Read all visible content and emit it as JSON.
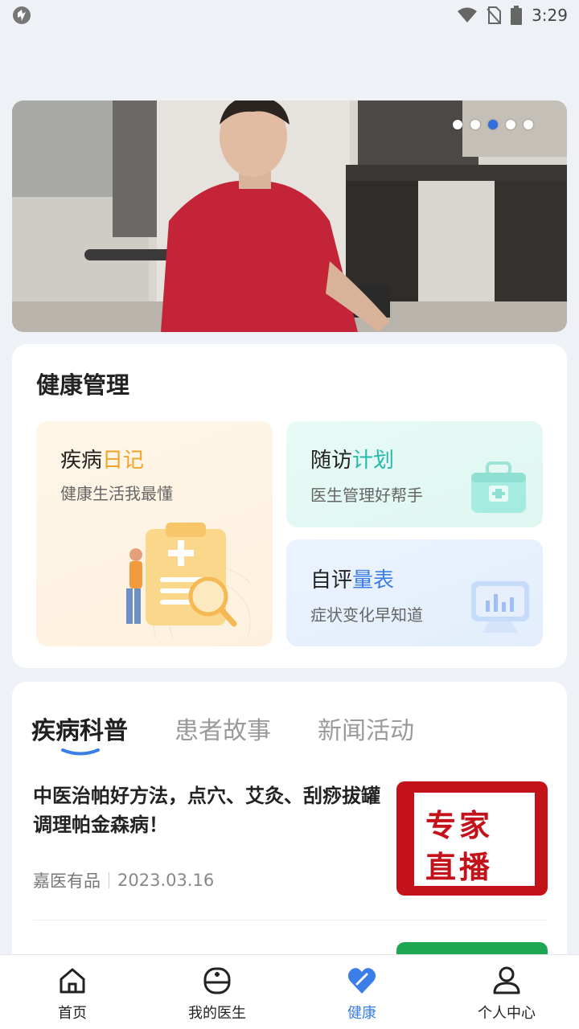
{
  "status_bar": {
    "time": "3:29"
  },
  "banner": {
    "dot_count": 5,
    "active_dot_index": 2
  },
  "health_management": {
    "title": "健康管理",
    "tiles": [
      {
        "title_plain": "疾病",
        "title_highlight": "日记",
        "subtitle": "健康生活我最懂",
        "accent": "#f2a329"
      },
      {
        "title_plain": "随访",
        "title_highlight": "计划",
        "subtitle": "医生管理好帮手",
        "accent": "#26b8a9"
      },
      {
        "title_plain": "自评",
        "title_highlight": "量表",
        "subtitle": "症状变化早知道",
        "accent": "#3c7ee8"
      }
    ]
  },
  "articles_section": {
    "tabs": [
      {
        "label": "疾病科普",
        "active": true
      },
      {
        "label": "患者故事",
        "active": false
      },
      {
        "label": "新闻活动",
        "active": false
      }
    ],
    "articles": [
      {
        "title": "中医治帕好方法，点穴、艾灸、刮痧拔罐调理帕金森病！",
        "source": "嘉医有品",
        "date": "2023.03.16",
        "thumb_line1": "专家",
        "thumb_line2": "直播"
      }
    ]
  },
  "bottom_nav": {
    "items": [
      {
        "label": "首页",
        "icon": "home-icon",
        "active": false
      },
      {
        "label": "我的医生",
        "icon": "doctor-icon",
        "active": false
      },
      {
        "label": "健康",
        "icon": "heart-icon",
        "active": true
      },
      {
        "label": "个人中心",
        "icon": "person-icon",
        "active": false
      }
    ]
  },
  "colors": {
    "accent_blue": "#3c7ee8",
    "background": "#eef1f6"
  }
}
